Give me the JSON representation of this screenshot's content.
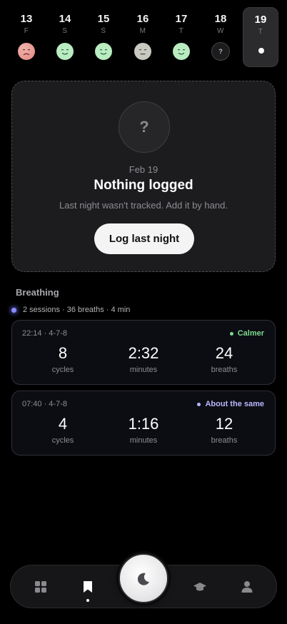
{
  "days": [
    {
      "num": "13",
      "weekday": "F",
      "mood": "bad",
      "color": "#e8938a"
    },
    {
      "num": "14",
      "weekday": "S",
      "mood": "good",
      "color": "#b9ecc1"
    },
    {
      "num": "15",
      "weekday": "S",
      "mood": "good",
      "color": "#b9ecc1"
    },
    {
      "num": "16",
      "weekday": "M",
      "mood": "neutral",
      "color": "#c9c9c2"
    },
    {
      "num": "17",
      "weekday": "T",
      "mood": "good",
      "color": "#b9ecc1"
    },
    {
      "num": "18",
      "weekday": "W",
      "mood": "unknown",
      "mark": "?"
    },
    {
      "num": "19",
      "weekday": "T",
      "selected": true
    }
  ],
  "log": {
    "icon": "?",
    "date": "Feb 19",
    "title": "Nothing logged",
    "subtitle": "Last night wasn't tracked. Add it by hand.",
    "button": "Log last night"
  },
  "breathing": {
    "title": "Breathing",
    "summary": "2 sessions · 36 breaths · 4 min",
    "sessions": [
      {
        "meta": "22:14 · 4-7-8",
        "mood": "Calmer",
        "mood_color": "#7fd98f",
        "stats": [
          {
            "value": "8",
            "label": "cycles"
          },
          {
            "value": "2:32",
            "label": "minutes"
          },
          {
            "value": "24",
            "label": "breaths"
          }
        ]
      },
      {
        "meta": "07:40 · 4-7-8",
        "mood": "About the same",
        "mood_color": "#b9b6ff",
        "stats": [
          {
            "value": "4",
            "label": "cycles"
          },
          {
            "value": "1:16",
            "label": "minutes"
          },
          {
            "value": "12",
            "label": "breaths"
          }
        ]
      }
    ]
  },
  "nav": {
    "items": [
      "grid-icon",
      "bookmark-icon",
      "moon-icon",
      "graduation-cap-icon",
      "person-icon"
    ],
    "active": "bookmark-icon"
  }
}
